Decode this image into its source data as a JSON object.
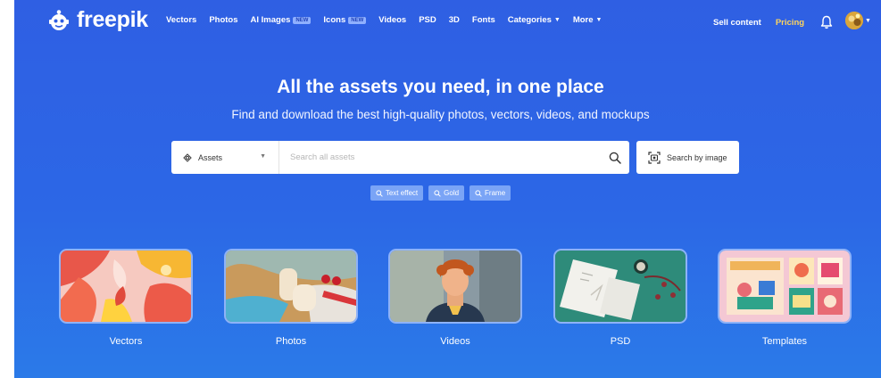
{
  "brand": {
    "name": "freepik"
  },
  "nav": {
    "items": [
      {
        "label": "Vectors",
        "badge": "",
        "caret": false
      },
      {
        "label": "Photos",
        "badge": "",
        "caret": false
      },
      {
        "label": "AI Images",
        "badge": "NEW",
        "caret": false
      },
      {
        "label": "Icons",
        "badge": "NEW",
        "caret": false
      },
      {
        "label": "Videos",
        "badge": "",
        "caret": false
      },
      {
        "label": "PSD",
        "badge": "",
        "caret": false
      },
      {
        "label": "3D",
        "badge": "",
        "caret": false
      },
      {
        "label": "Fonts",
        "badge": "",
        "caret": false
      },
      {
        "label": "Categories",
        "badge": "",
        "caret": true
      },
      {
        "label": "More",
        "badge": "",
        "caret": true
      }
    ],
    "sell_content": "Sell content",
    "pricing": "Pricing",
    "notification_icon": "bell-icon",
    "avatar_icon": "avatar"
  },
  "hero": {
    "title": "All the assets you need, in one place",
    "subtitle": "Find and download the best high-quality photos, vectors, videos, and mockups"
  },
  "search": {
    "type_selected": "Assets",
    "placeholder": "Search all assets",
    "value": "",
    "search_by_image": "Search by image",
    "suggestions": [
      "Text effect",
      "Gold",
      "Frame"
    ]
  },
  "categories": [
    {
      "label": "Vectors"
    },
    {
      "label": "Photos"
    },
    {
      "label": "Videos"
    },
    {
      "label": "PSD"
    },
    {
      "label": "Templates"
    }
  ],
  "colors": {
    "hero_bg": "#2f5fe3",
    "pricing": "#ffd55c",
    "chip_bg": "#7aa4f6",
    "card_border": "#8eb2f8"
  }
}
